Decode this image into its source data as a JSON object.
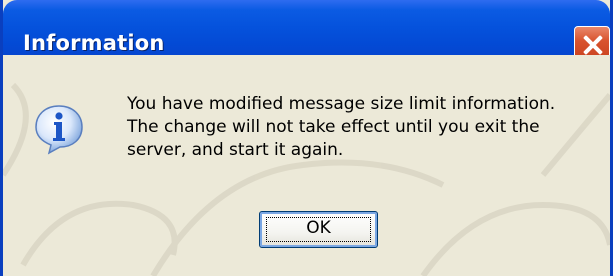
{
  "window": {
    "title": "Information",
    "close_icon": "close-icon"
  },
  "dialog": {
    "icon": "info-icon",
    "message_lines": [
      "You have modified message size limit information.",
      "The change will not take effect until you exit the",
      "server, and start it again."
    ],
    "ok_label": "OK"
  },
  "colors": {
    "titlebar": "#0552dc",
    "close_button": "#d9542f",
    "background": "#ece9d8"
  }
}
